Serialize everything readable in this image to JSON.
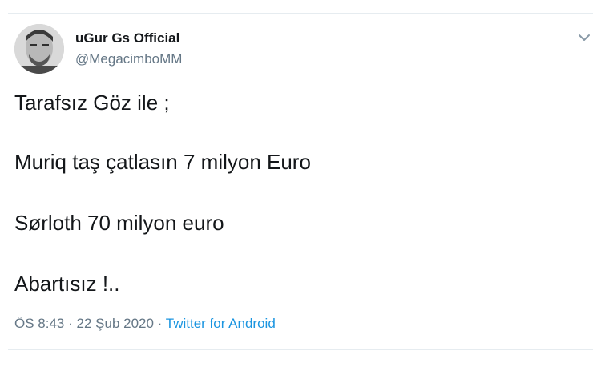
{
  "tweet": {
    "display_name": "uGur Gs Official",
    "handle": "@MegacimboMM",
    "lines": [
      "Tarafsız Göz ile ;",
      "Muriq taş çatlasın 7 milyon Euro",
      "Sørloth 70 milyon euro",
      "Abartısız !.."
    ],
    "time": "ÖS 8:43",
    "separator": "·",
    "date": "22 Şub 2020",
    "source": "Twitter for Android",
    "menu_icon": "chevron-down-icon",
    "colors": {
      "text": "#14171a",
      "secondary": "#657786",
      "link": "#1b95e0",
      "border": "#e6ecf0"
    }
  }
}
